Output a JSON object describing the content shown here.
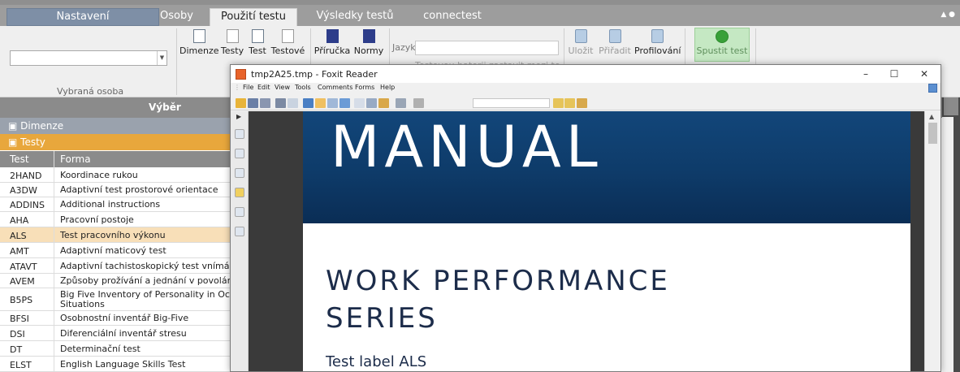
{
  "tabs": [
    "Nastavení",
    "Osoby",
    "Použití testu",
    "Výsledky testů",
    "connectest"
  ],
  "ribbon": {
    "group_label": "Vybraná osoba",
    "buttons": [
      "Dimenze",
      "Testy",
      "Test",
      "Testové",
      "Příručka",
      "Normy"
    ],
    "jazyk_label": "Jazyk",
    "checkbox_label": "Testovou baterii zastavit mezi testy",
    "right_buttons": [
      "Uložit",
      "Přiřadit",
      "Profilování"
    ],
    "run_label": "Spustit test"
  },
  "panel": {
    "header": "Výběr",
    "dimenze": "Dimenze",
    "testy": "Testy",
    "col_test": "Test",
    "col_forma": "Forma",
    "rows": [
      {
        "test": "2HAND",
        "forma": "Koordinace rukou"
      },
      {
        "test": "A3DW",
        "forma": "Adaptivní test prostorové orientace"
      },
      {
        "test": "ADDINS",
        "forma": "Additional instructions"
      },
      {
        "test": "AHA",
        "forma": "Pracovní postoje"
      },
      {
        "test": "ALS",
        "forma": "Test pracovního výkonu"
      },
      {
        "test": "AMT",
        "forma": "Adaptivní maticový test"
      },
      {
        "test": "ATAVT",
        "forma": "Adaptivní tachistoskopický test vnímá"
      },
      {
        "test": "AVEM",
        "forma": "Způsoby prožívání a jednání v povolán"
      },
      {
        "test": "B5PS",
        "forma": "Big Five Inventory of Personality in Oc Situations"
      },
      {
        "test": "BFSI",
        "forma": "Osobnostní inventář Big-Five"
      },
      {
        "test": "DSI",
        "forma": "Diferenciální inventář stresu"
      },
      {
        "test": "DT",
        "forma": "Determinační test"
      },
      {
        "test": "ELST",
        "forma": "English Language Skills Test"
      }
    ]
  },
  "foxit": {
    "title": "tmp2A25.tmp - Foxit Reader",
    "menu": [
      "File",
      "Edit",
      "View",
      "Tools",
      "Comments",
      "Forms",
      "Help"
    ],
    "page": {
      "banner": "MANUAL",
      "heading_line1": "WORK PERFORMANCE",
      "heading_line2": "SERIES",
      "test_label": "Test label ALS"
    }
  }
}
